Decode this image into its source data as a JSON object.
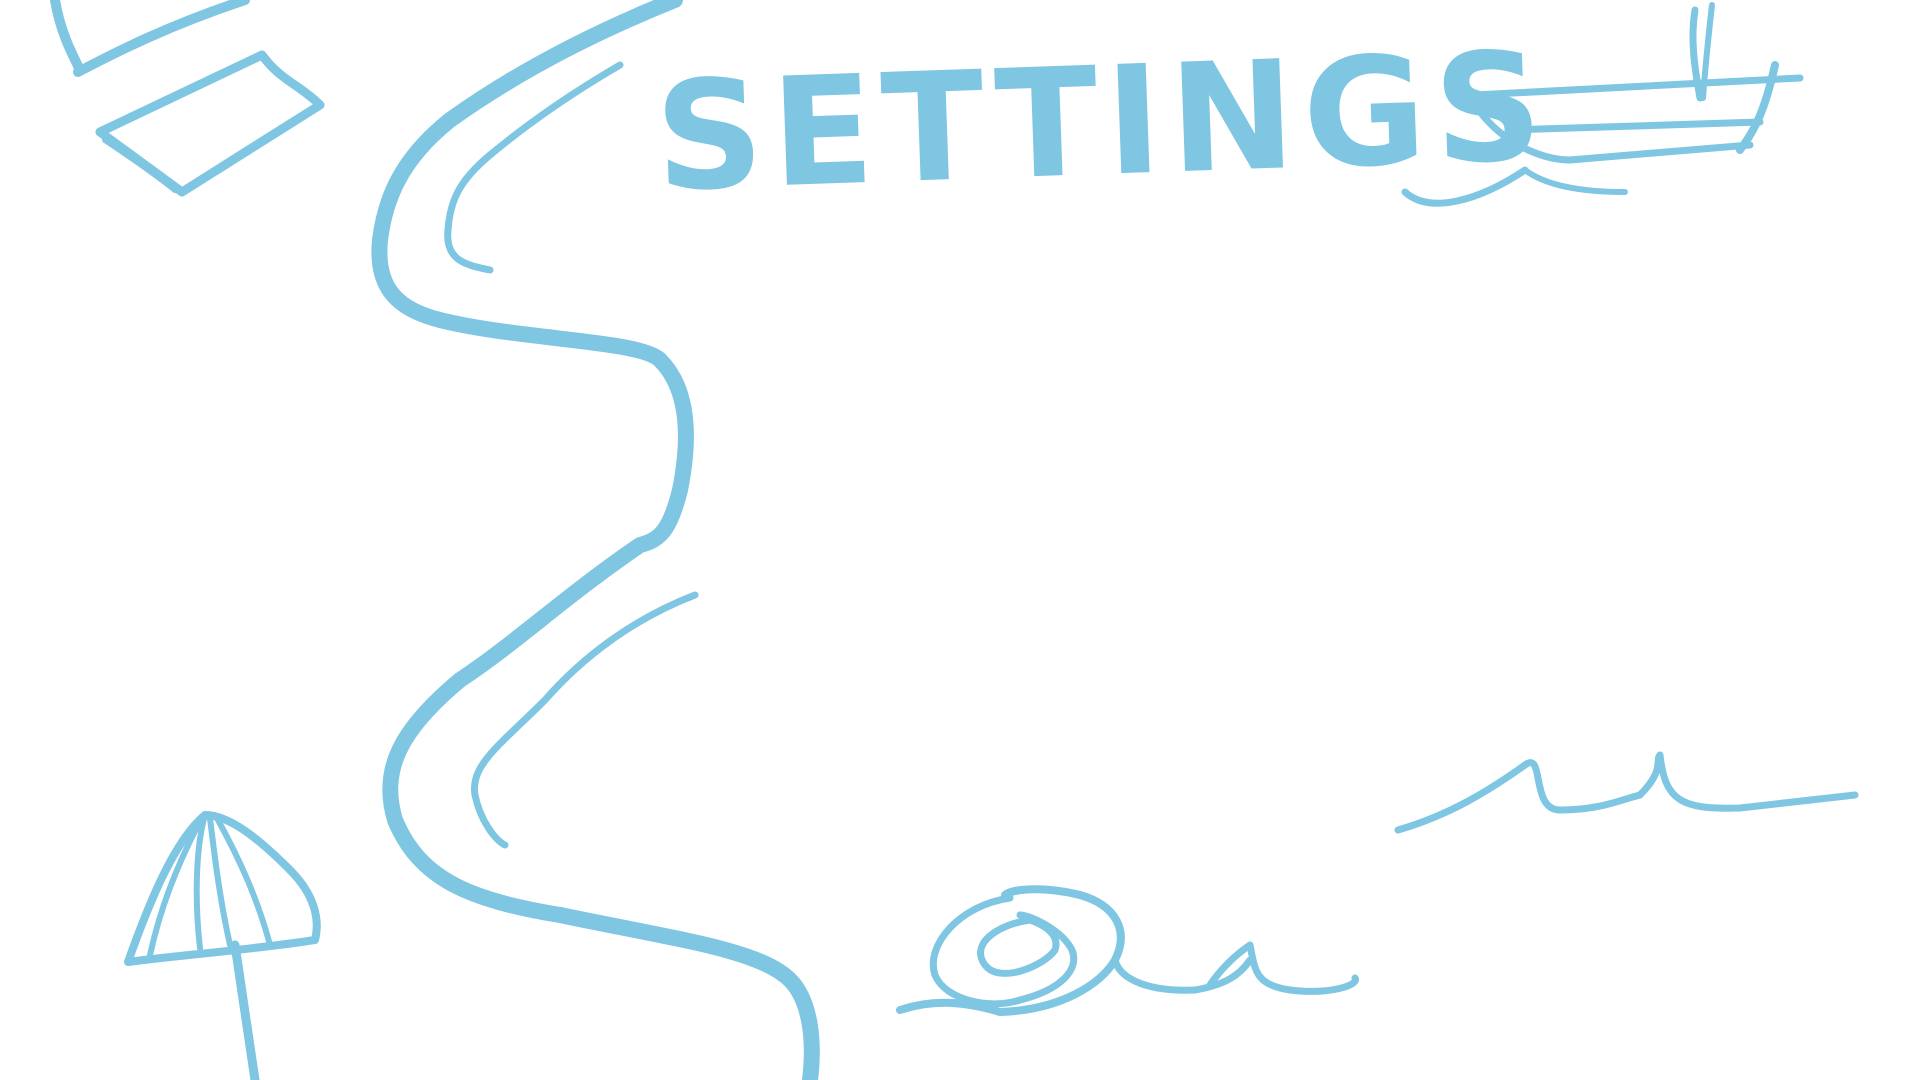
{
  "menu": {
    "title": "SETTINGS"
  },
  "theme": {
    "ink_color": "#7ec6e2",
    "background": "#ffffff"
  },
  "doodles": {
    "top_left": "book-icon",
    "top_right": "boat-icon",
    "middle_right": "wave-icon",
    "bottom_left": "umbrella-icon",
    "bottom_center": "snail-icon",
    "center": "river-path"
  }
}
